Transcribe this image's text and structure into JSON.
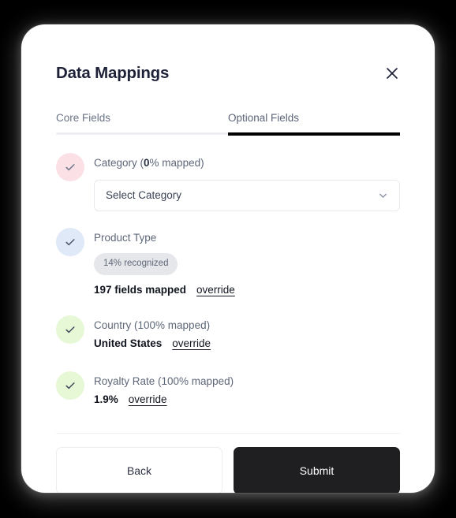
{
  "dialog": {
    "title": "Data Mappings",
    "close_icon": "close-icon"
  },
  "tabs": [
    {
      "label": "Core Fields",
      "active": false
    },
    {
      "label": "Optional Fields",
      "active": true
    }
  ],
  "fields": [
    {
      "name": "category",
      "title_prefix": "Category (",
      "title_strong": "0",
      "title_suffix": "% mapped)",
      "status_color": "#fbe0e6",
      "check_icon": "check-icon",
      "select": {
        "value": "Select Category",
        "chevron_icon": "chevron-down-icon"
      }
    },
    {
      "name": "product-type",
      "title": "Product Type",
      "status_color": "#dfe9f7",
      "check_icon": "check-icon",
      "badge": "14% recognized",
      "value": "197 fields mapped",
      "override": "override"
    },
    {
      "name": "country",
      "title": "Country (100% mapped)",
      "status_color": "#e6f8d6",
      "check_icon": "check-icon",
      "value": "United States",
      "override": "override"
    },
    {
      "name": "royalty-rate",
      "title": "Royalty Rate (100% mapped)",
      "status_color": "#e6f8d6",
      "check_icon": "check-icon",
      "value": "1.9%",
      "override": "override"
    }
  ],
  "footer": {
    "back_label": "Back",
    "submit_label": "Submit"
  },
  "colors": {
    "accent_dark": "#1f1f22",
    "title": "#1d2238",
    "muted_text": "#5e6778",
    "tab_active_underline": "#000000",
    "tab_inactive_underline": "#eceef1",
    "badge_bg": "#e6e7ea"
  }
}
